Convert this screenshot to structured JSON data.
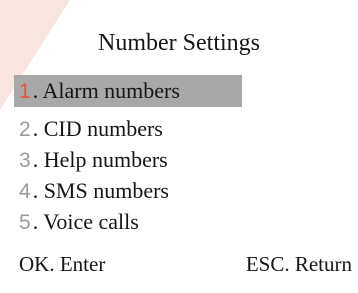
{
  "screen": {
    "title": "Number Settings",
    "menu": [
      {
        "num": "1",
        "label": ". Alarm numbers"
      },
      {
        "num": "2",
        "label": ". CID numbers"
      },
      {
        "num": "3",
        "label": ". Help numbers"
      },
      {
        "num": "4",
        "label": ". SMS numbers"
      },
      {
        "num": "5",
        "label": ". Voice calls"
      }
    ],
    "selected_index": 0,
    "footer": {
      "ok": "OK. Enter",
      "esc": "ESC. Return"
    }
  },
  "colors": {
    "highlight": "#a8a8a8",
    "selected_number": "#e8553a",
    "number": "#9a9a9a",
    "text": "#161616",
    "corner_mark": "#f1c9c2"
  }
}
